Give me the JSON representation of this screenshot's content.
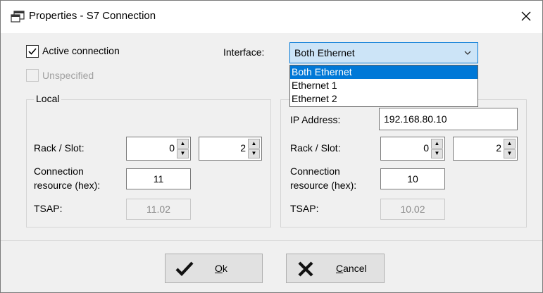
{
  "window": {
    "title": "Properties - S7 Connection",
    "close_glyph": "✕"
  },
  "options": {
    "active_connection_label": "Active connection",
    "active_connection_checked": true,
    "unspecified_label": "Unspecified",
    "unspecified_checked": false
  },
  "interface": {
    "label": "Interface:",
    "selected": "Both Ethernet",
    "options": [
      "Both Ethernet",
      "Ethernet 1",
      "Ethernet 2"
    ]
  },
  "local": {
    "group_title": "Local",
    "rack_slot_label": "Rack / Slot:",
    "rack": "0",
    "slot": "2",
    "conn_resource_label_1": "Connection",
    "conn_resource_label_2": "resource (hex):",
    "conn_resource": "11",
    "tsap_label": "TSAP:",
    "tsap": "11.02"
  },
  "remote": {
    "ip_label": "IP Address:",
    "ip": "192.168.80.10",
    "rack_slot_label": "Rack / Slot:",
    "rack": "0",
    "slot": "2",
    "conn_resource_label_1": "Connection",
    "conn_resource_label_2": "resource (hex):",
    "conn_resource": "10",
    "tsap_label": "TSAP:",
    "tsap": "10.02"
  },
  "buttons": {
    "ok_mnemonic": "O",
    "ok_rest": "k",
    "cancel_mnemonic": "C",
    "cancel_rest": "ancel"
  },
  "icons": {
    "app": "window-icon",
    "close": "close-icon",
    "check": "checkmark-icon",
    "cross": "cross-icon",
    "chevron": "chevron-down-icon",
    "spin_up": "spin-up-icon",
    "spin_down": "spin-down-icon"
  },
  "colors": {
    "accent": "#0078d7",
    "select_bg": "#cce4f7",
    "dialog_bg": "#f0f0f0"
  }
}
